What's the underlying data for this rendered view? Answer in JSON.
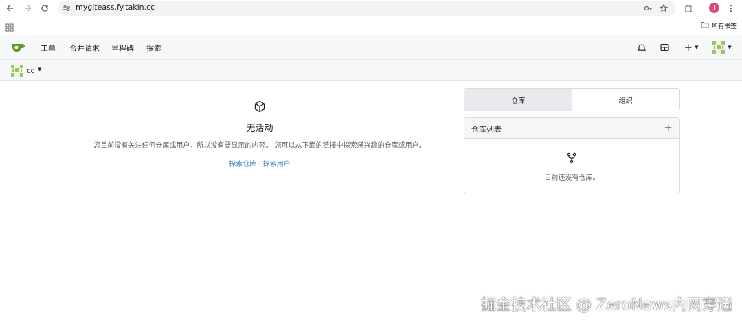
{
  "browser": {
    "url": "mygiteass.fy.takin.cc",
    "profile_initial": "I",
    "bookmarks_all": "所有书签",
    "icons": [
      "back-icon",
      "forward-icon",
      "reload-icon",
      "site-info-icon",
      "key-icon",
      "star-icon",
      "extensions-icon",
      "menu-icon",
      "apps-icon",
      "folder-icon"
    ]
  },
  "navbar": {
    "items": [
      "工单",
      "合并请求",
      "里程碑",
      "探索"
    ],
    "plus_label": "+"
  },
  "context": {
    "user": "cc"
  },
  "feed": {
    "title": "无活动",
    "description": "您目前没有关注任何仓库或用户，所以没有要显示的内容。 您可以从下面的链接中探索感兴趣的仓库或用户。",
    "link_repos": "探索仓库",
    "separator": " · ",
    "link_users": "探索用户"
  },
  "sidebar": {
    "tabs": [
      "仓库",
      "组织"
    ],
    "active_tab": 0,
    "repo_list_title": "仓库列表",
    "add_label": "+",
    "empty_text": "目前还没有仓库。"
  },
  "watermark": "掘金技术社区 @ ZeroNews内网穿透",
  "colors": {
    "accent_green": "#609926",
    "link_blue": "#4183c4",
    "profile_pink": "#e3487a"
  }
}
